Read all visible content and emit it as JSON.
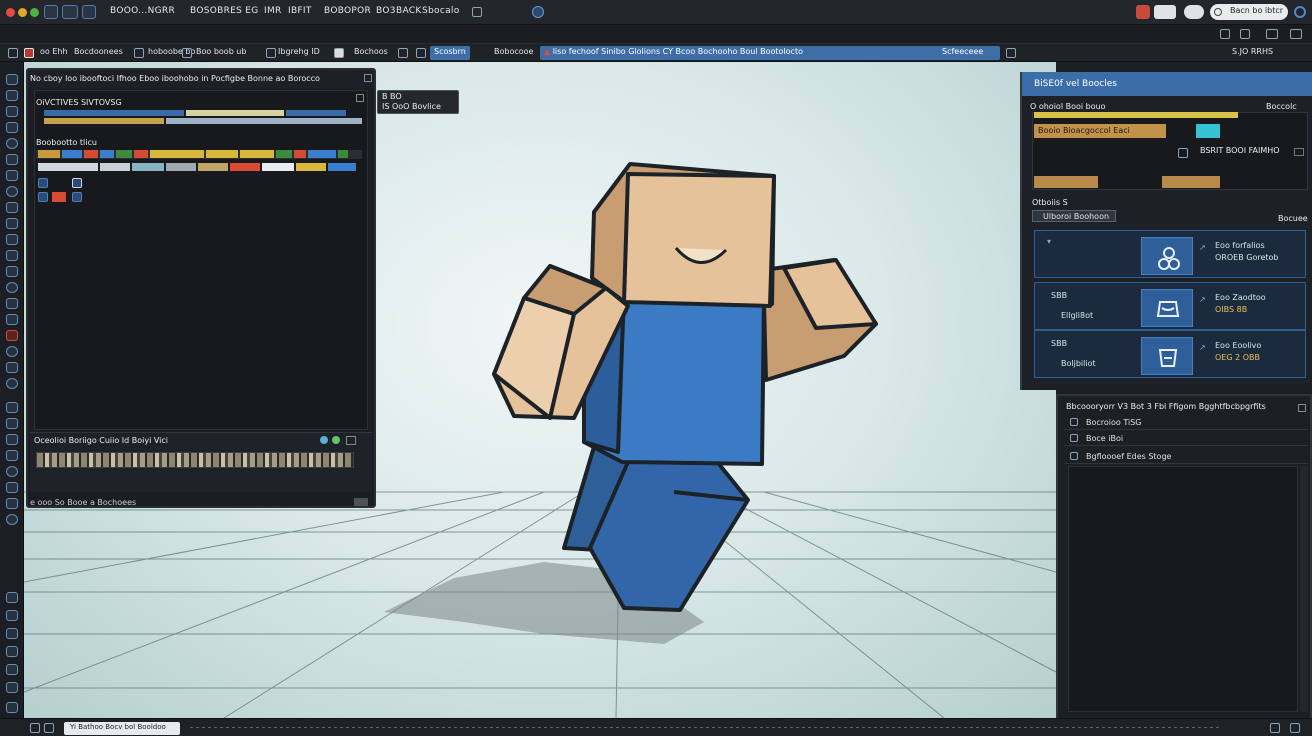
{
  "titlebar": {
    "items": [
      "BOOO...NGRR",
      "BOSOBRES EG",
      "IMR",
      "IBFIT",
      "BOBOPOR",
      "BO3",
      "BACK",
      "Sbocalo"
    ],
    "search_pill": "Bacn bo ibtcr",
    "window_dots": [
      "#e14d44",
      "#e2a72f",
      "#4fb04a"
    ]
  },
  "toolbar": {
    "items": [
      "oo Ehh",
      "Bocdoonees",
      "hoboobe bo",
      "Boo boob ub",
      "Ibgrehg ID",
      "Bochoos",
      "Scosbrn",
      "Bobocooe"
    ],
    "tab_title": "liso fechoof Sinibo Glolions CY Bcoo Bochooho Boul Bootolocto",
    "right_text": "Scfeeceee",
    "far_right": "S.JO RRHS"
  },
  "left_panel": {
    "header": "No cboy loo ibooftoci Ifhoo Eboo iboohobo in Pocfigbe Bonne ao Borocco",
    "section1_title": "OiVCTIVES SIVTOVSG",
    "section2_title": "Boobootto tlicu",
    "thumb_label": "Oceolioi Boriigo Cuiio Id Boiyi Vici",
    "footer": "e ooo So Booe a Bochoees"
  },
  "badge": {
    "line1": "B BO",
    "line2": "IS OoO    Bovlice"
  },
  "right_panel": {
    "title": "BiSE0f vel Boocles",
    "subtitle": "O ohoiol Booi bouo",
    "subtitle_right": "Boccolc",
    "timeline_label": "Booio Bioacgoccol Eaci",
    "timeline_right": "BSRIT BOOI FAIMHO",
    "section_label": "Otboiis S",
    "filter_label": "Ulboroi Boohoon",
    "filter_right": "Bocuee",
    "cards": [
      {
        "left_top": "",
        "left_bottom": "",
        "text1": "Eoo forfalios",
        "text2": "OROEB Goretob",
        "icon": "node-icon"
      },
      {
        "left_top": "SBB",
        "left_bottom": "Ellgli8ot",
        "text1": "Eoo Zaodtoo",
        "text2": "OIBS 8B",
        "icon": "hat-icon"
      },
      {
        "left_top": "SBB",
        "left_bottom": "Boljbiliot",
        "text1": "Eoo Eoolivo",
        "text2": "OEG 2 OBB",
        "icon": "bucket-icon"
      }
    ]
  },
  "right_panel2": {
    "header": "Bbcoooryorr V3 Bot 3 Fbl Ffigom Bgghtfbcbpgrfits",
    "rows": [
      "Bocroioo TiSG",
      "Boce iBoi",
      "Bgfloooef Edes Stoge"
    ]
  },
  "statusbar": {
    "tag": "Yi Bathoo Bocv bol Booldoo"
  },
  "colors": {
    "accent": "#3b6ea9",
    "character_skin": "#e6c29b",
    "character_shirt": "#3b7bc4",
    "character_pants": "#2f5f98"
  }
}
